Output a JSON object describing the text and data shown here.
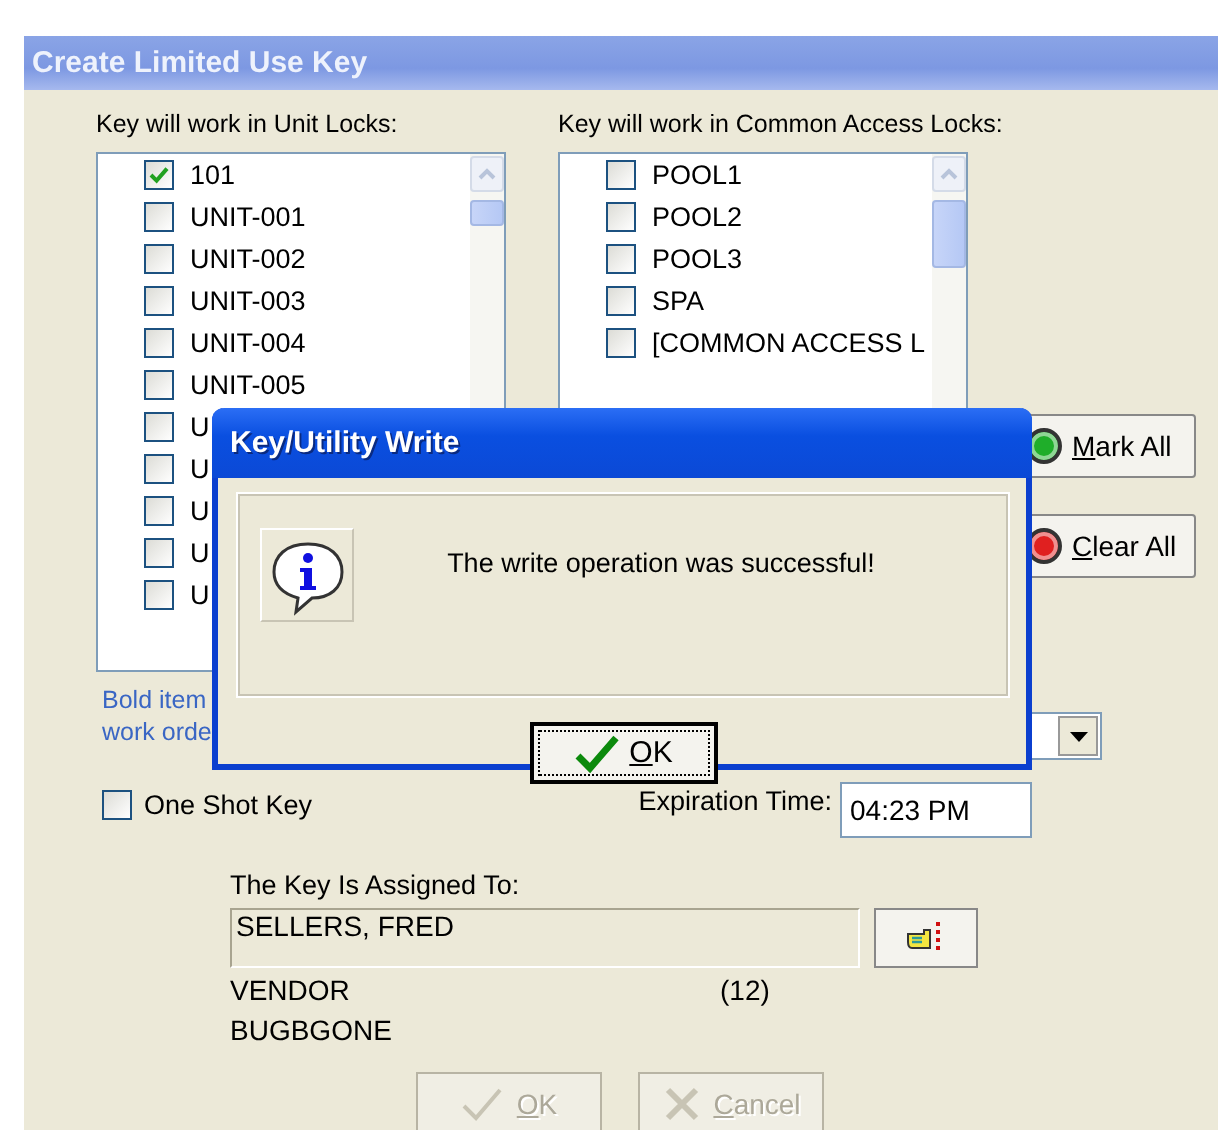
{
  "window": {
    "title": "Create Limited Use Key"
  },
  "unit_locks": {
    "label": "Key will work in Unit Locks:",
    "items": [
      {
        "label": "101",
        "checked": true
      },
      {
        "label": "UNIT-001",
        "checked": false
      },
      {
        "label": "UNIT-002",
        "checked": false
      },
      {
        "label": "UNIT-003",
        "checked": false
      },
      {
        "label": "UNIT-004",
        "checked": false
      },
      {
        "label": "UNIT-005",
        "checked": false
      },
      {
        "label": "U",
        "checked": false
      },
      {
        "label": "U",
        "checked": false
      },
      {
        "label": "U",
        "checked": false
      },
      {
        "label": "U",
        "checked": false
      },
      {
        "label": "U",
        "checked": false
      }
    ]
  },
  "common_locks": {
    "label": "Key will work in Common Access Locks:",
    "items": [
      {
        "label": "POOL1",
        "checked": false
      },
      {
        "label": "POOL2",
        "checked": false
      },
      {
        "label": "POOL3",
        "checked": false
      },
      {
        "label": "SPA",
        "checked": false
      },
      {
        "label": "[COMMON ACCESS L",
        "checked": false
      }
    ]
  },
  "side_buttons": [
    {
      "label": "Mark All",
      "color": "#1fae2a"
    },
    {
      "label": "Clear All",
      "color": "#e02020"
    }
  ],
  "note_lines": [
    "Bold item",
    "work orde"
  ],
  "one_shot_key": {
    "label": "One Shot Key",
    "checked": false
  },
  "expiration_time": {
    "label": "Expiration Time:",
    "value": "04:23 PM"
  },
  "assigned": {
    "label": "The Key Is Assigned To:",
    "name": "SELLERS, FRED",
    "type": "VENDOR",
    "count": "(12)",
    "company": "BUGBGONE"
  },
  "footer_buttons": [
    {
      "kind": "ok",
      "label": "OK",
      "disabled": true
    },
    {
      "kind": "cancel",
      "label": "Cancel",
      "disabled": true
    }
  ],
  "dialog": {
    "title": "Key/Utility Write",
    "message": "The write operation was successful!",
    "button": {
      "label": "OK",
      "focused": true
    }
  }
}
